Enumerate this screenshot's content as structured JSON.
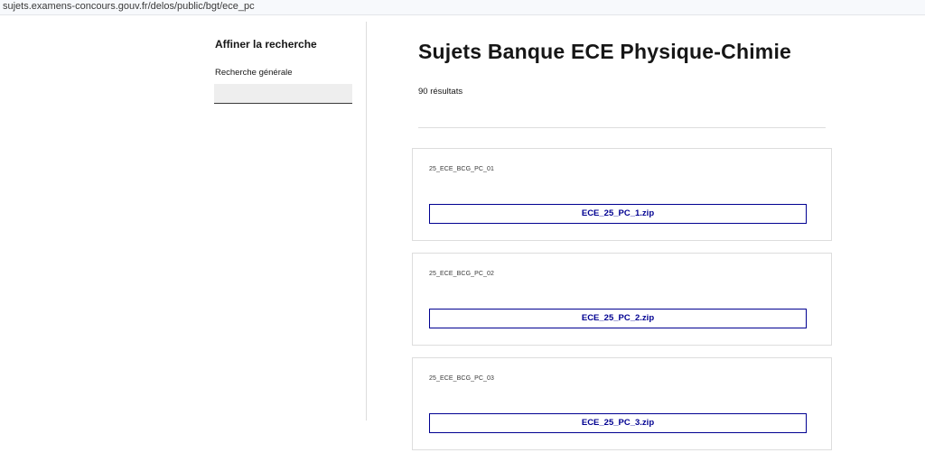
{
  "browser": {
    "url": "sujets.examens-concours.gouv.fr/delos/public/bgt/ece_pc"
  },
  "sidebar": {
    "title": "Affiner la recherche",
    "search_label": "Recherche générale",
    "search_value": ""
  },
  "main": {
    "title": "Sujets Banque ECE Physique-Chimie",
    "result_count": "90 résultats",
    "results": [
      {
        "code": "25_ECE_BCG_PC_01",
        "file": "ECE_25_PC_1.zip"
      },
      {
        "code": "25_ECE_BCG_PC_02",
        "file": "ECE_25_PC_2.zip"
      },
      {
        "code": "25_ECE_BCG_PC_03",
        "file": "ECE_25_PC_3.zip"
      }
    ]
  },
  "colors": {
    "accent": "#000091",
    "border": "#dddddd",
    "input_bg": "#eeeeee"
  }
}
